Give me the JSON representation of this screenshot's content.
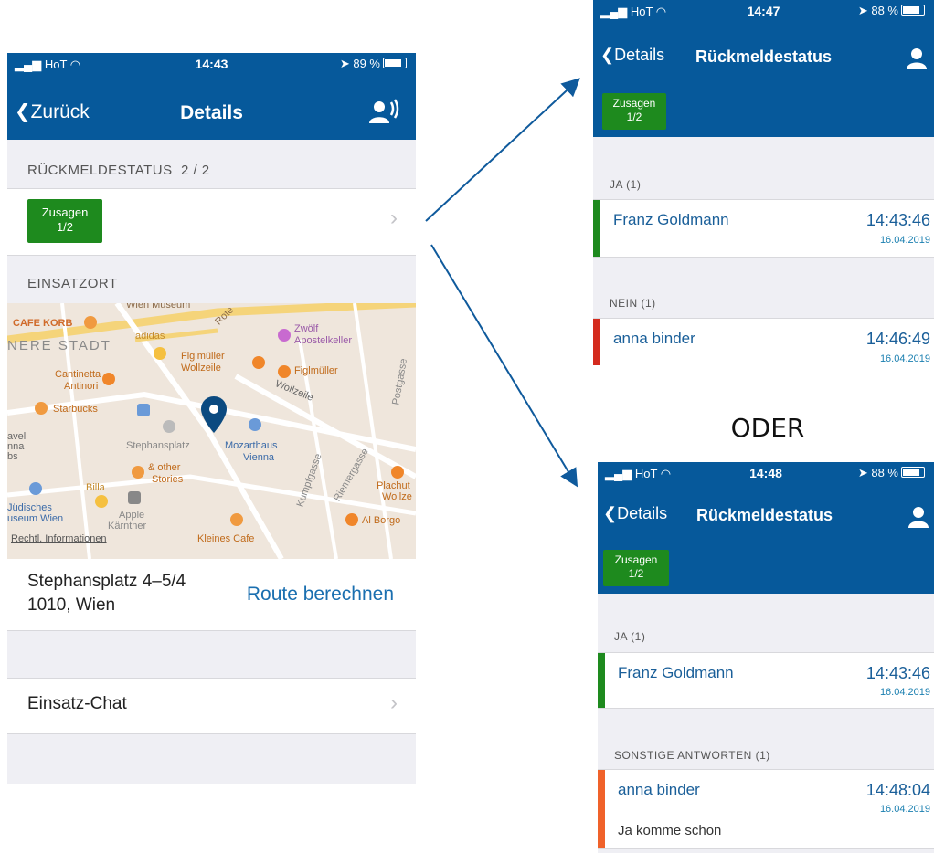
{
  "left": {
    "status": {
      "carrier": "HoT",
      "time": "14:43",
      "battery": "89 %"
    },
    "nav": {
      "back": "Zurück",
      "title": "Details"
    },
    "rueck_header": "RÜCKMELDESTATUS  2 / 2",
    "badge": {
      "line1": "Zusagen",
      "line2": "1/2"
    },
    "einsatzort_header": "EINSATZORT",
    "map": {
      "labels": [
        "CAFE KORB",
        "NERE STADT",
        "adidas",
        "Zwölf",
        "Apostelkeller",
        "Figlmüller",
        "Wollzeile",
        "Figlmüller",
        "Cantinetta",
        "Antinori",
        "Starbucks",
        "Wollzeile",
        "Stephansplatz",
        "Mozarthaus",
        "Vienna",
        "& other",
        "Stories",
        "Billa",
        "Jüdisches",
        "useum Wien",
        "Apple",
        "Kärntner",
        "Plachut",
        "Wollze",
        "Al Borgo",
        "Kleines Cafe",
        "Rechtl. Informationen",
        "avel",
        "nna",
        "bs",
        "Kumpfgasse",
        "Riemergasse",
        "Postgasse",
        "Rote",
        "Wien Museum"
      ]
    },
    "address": {
      "line1": "Stephansplatz 4–5/4",
      "line2": "1010, Wien"
    },
    "route": "Route berechnen",
    "chat": "Einsatz-Chat"
  },
  "top_right": {
    "status": {
      "carrier": "HoT",
      "time": "14:47",
      "battery": "88 %"
    },
    "nav": {
      "back": "Details",
      "title": "Rückmeldestatus"
    },
    "badge": {
      "line1": "Zusagen",
      "line2": "1/2"
    },
    "sections": [
      {
        "header": "JA (1)",
        "name": "Franz Goldmann",
        "time": "14:43:46",
        "date": "16.04.2019",
        "color": "#1e8a1e"
      },
      {
        "header": "NEIN (1)",
        "name": "anna binder",
        "time": "14:46:49",
        "date": "16.04.2019",
        "color": "#d42b1e"
      }
    ]
  },
  "oder": "ODER",
  "bottom_right": {
    "status": {
      "carrier": "HoT",
      "time": "14:48",
      "battery": "88 %"
    },
    "nav": {
      "back": "Details",
      "title": "Rückmeldestatus"
    },
    "badge": {
      "line1": "Zusagen",
      "line2": "1/2"
    },
    "sections": [
      {
        "header": "JA (1)",
        "name": "Franz Goldmann",
        "time": "14:43:46",
        "date": "16.04.2019",
        "color": "#1e8a1e"
      },
      {
        "header": "SONSTIGE ANTWORTEN (1)",
        "name": "anna binder",
        "time": "14:48:04",
        "date": "16.04.2019",
        "comment": "Ja komme schon",
        "color": "#f0622a"
      }
    ]
  }
}
